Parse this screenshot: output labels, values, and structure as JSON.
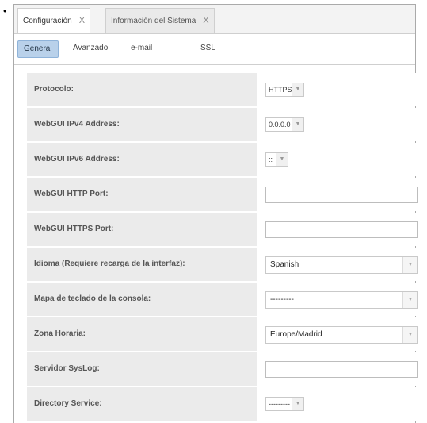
{
  "bullet": "•",
  "tabs": [
    {
      "label": "Configuración",
      "close": "X"
    },
    {
      "label": "Información del Sistema",
      "close": "X"
    }
  ],
  "subtabs": [
    "General",
    "Avanzado",
    "e-mail",
    "SSL"
  ],
  "fields": {
    "protocolo": {
      "label": "Protocolo:",
      "value": "HTTPS"
    },
    "ipv4": {
      "label": "WebGUI IPv4 Address:",
      "value": "0.0.0.0"
    },
    "ipv6": {
      "label": "WebGUI IPv6 Address:",
      "value": "::"
    },
    "http_port": {
      "label": "WebGUI HTTP Port:",
      "value": ""
    },
    "https_port": {
      "label": "WebGUI HTTPS Port:",
      "value": ""
    },
    "idioma": {
      "label": "Idioma (Requiere recarga de la interfaz):",
      "value": "Spanish"
    },
    "teclado": {
      "label": "Mapa de teclado de la consola:",
      "value": "---------"
    },
    "zona": {
      "label": "Zona Horaria:",
      "value": "Europe/Madrid"
    },
    "syslog": {
      "label": "Servidor SysLog:",
      "value": ""
    },
    "directory": {
      "label": "Directory Service:",
      "value": "---------"
    }
  },
  "icons": {
    "dropdown": "chevron-down-icon",
    "close": "close-icon"
  },
  "colors": {
    "active_subtab": "#b9d1ea",
    "label_bg": "#ebebeb"
  }
}
